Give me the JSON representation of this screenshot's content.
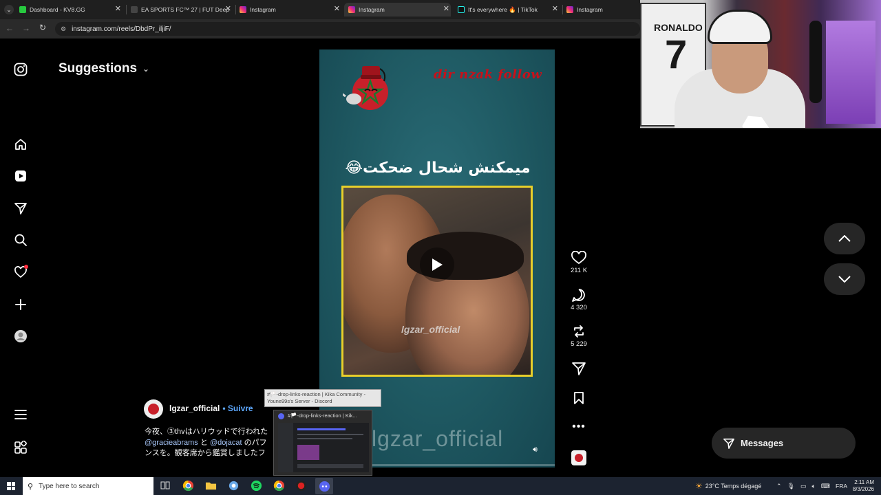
{
  "browser": {
    "tabs": [
      {
        "title": "Dashboard - KV8.GG",
        "fav_color": "#27c93f"
      },
      {
        "title": "EA SPORTS FC™ 27 | FUT Deep",
        "fav_color": "#1b1b1b"
      },
      {
        "title": "Instagram",
        "fav_color": "#e1306c"
      },
      {
        "title": "Instagram",
        "fav_color": "#e1306c"
      },
      {
        "title": "It's everywhere 🔥 | TikTok",
        "fav_color": "#111111"
      },
      {
        "title": "Instagram",
        "fav_color": "#e1306c"
      }
    ],
    "url": "instagram.com/reels/DbdPr_iljiF/"
  },
  "header": {
    "suggestions_label": "Suggestions"
  },
  "nav_icons": [
    "instagram-logo-icon",
    "home-icon",
    "reels-icon",
    "messages-icon",
    "search-icon",
    "notifications-icon",
    "create-icon",
    "profile-icon",
    "menu-icon",
    "more-apps-icon"
  ],
  "reel": {
    "top_text": "dir nzak follow",
    "caption_ar": "ميمكنش شحال ضحكت😂",
    "video_watermark": "lgzar_official",
    "bottom_watermark": "lgzar_official"
  },
  "actions": {
    "likes": "211 K",
    "comments": "4 320",
    "shares": "5 229"
  },
  "post": {
    "username": "lgzar_official",
    "follow_label": "• Suivre",
    "caption_line1": "今夜、③thvはハリウッドで行われた",
    "mention1": "@gracieabrams",
    "caption_and": " と ",
    "mention2": "@dojacat",
    "caption_tail": " のパフ",
    "caption_line3": "ンスを。観客席から鑑賞しましたフ"
  },
  "discord_tooltip": {
    "line1": "#🏳️-drop-links-reaction | Kika Community -",
    "line2": "Youne99s's Server - Discord",
    "preview_title": "#🏳️-drop-links-reaction | Kik..."
  },
  "messages_label": "Messages",
  "webcam": {
    "jersey_name": "RONALDO",
    "jersey_number": "7"
  },
  "taskbar": {
    "search_placeholder": "Type here to search",
    "weather": "23°C  Temps dégagé",
    "lang": "FRA",
    "time": "2:11 AM",
    "date": "8/3/2026"
  },
  "colors": {
    "accent_blue": "#5da8ff",
    "reel_frame": "#e8cf2a",
    "notification_dot": "#ff3040"
  }
}
